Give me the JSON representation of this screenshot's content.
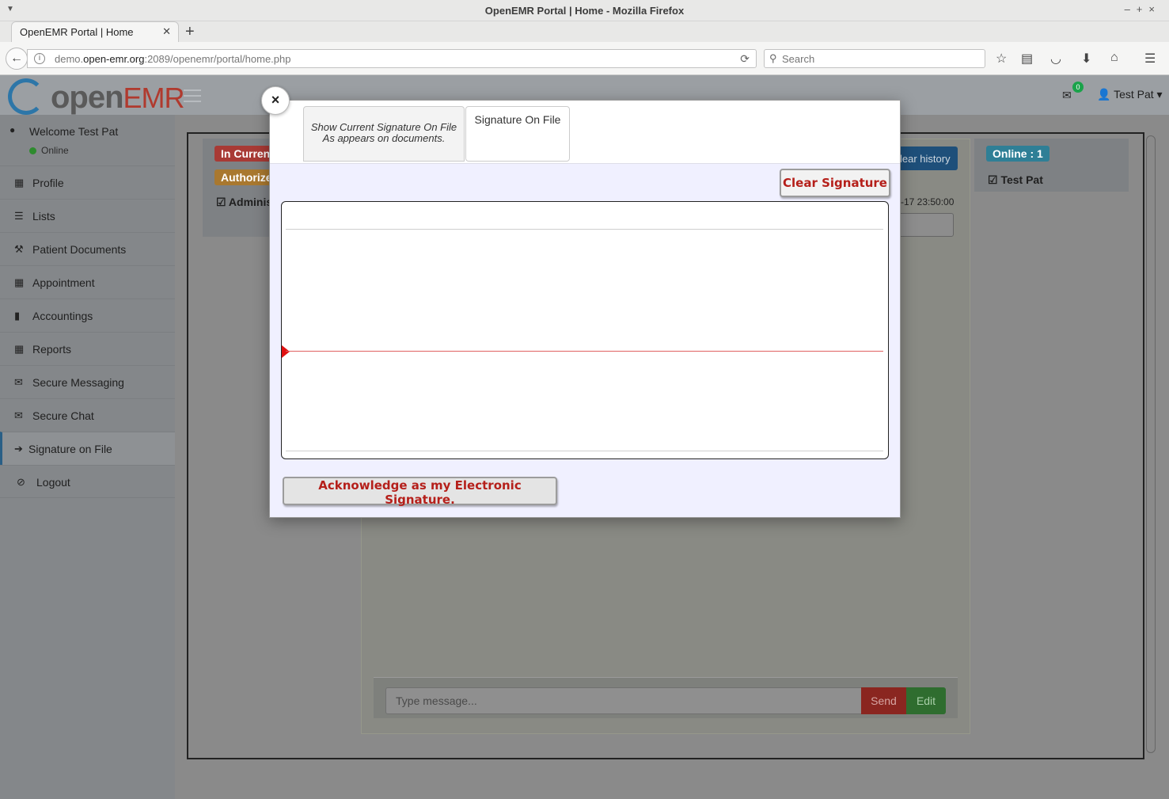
{
  "window": {
    "title": "OpenEMR Portal | Home - Mozilla Firefox"
  },
  "browser": {
    "tab_label": "OpenEMR Portal | Home",
    "url_prefix": "demo.",
    "url_host": "open-emr.org",
    "url_rest": ":2089/openemr/portal/home.php",
    "search_placeholder": "Search"
  },
  "portal": {
    "logo_text": "open",
    "logo_emr": "EMR",
    "mail_count": "0",
    "user_name": "Test Pat ▾",
    "welcome": "Welcome Test Pat",
    "status": "Online"
  },
  "sidebar": {
    "items": [
      {
        "label": "Profile",
        "icon": "calendar-icon"
      },
      {
        "label": "Lists",
        "icon": "list-icon"
      },
      {
        "label": "Patient Documents",
        "icon": "gavel-icon"
      },
      {
        "label": "Appointment",
        "icon": "calendar-icon"
      },
      {
        "label": "Accountings",
        "icon": "book-icon"
      },
      {
        "label": "Reports",
        "icon": "calendar-icon"
      },
      {
        "label": "Secure Messaging",
        "icon": "envelope-icon"
      },
      {
        "label": "Secure Chat",
        "icon": "envelope-icon"
      },
      {
        "label": "Signature on File",
        "icon": "sign-in-icon"
      },
      {
        "label": "Logout",
        "icon": "ban-icon"
      }
    ]
  },
  "chat": {
    "badge_current": "In Curren",
    "badge_authorized": "Authorize",
    "admin_label": "Adminis",
    "clear_history": "lear history",
    "timestamp": "-17 23:50:00",
    "online_badge": "Online : 1",
    "online_user": "Test Pat",
    "message_placeholder": "Type message...",
    "send_label": "Send",
    "edit_label": "Edit"
  },
  "modal": {
    "close_label": "×",
    "tab1_line1": "Show Current Signature On File",
    "tab1_line2": "As appears on documents.",
    "tab2_label": "Signature On File",
    "clear_signature": "Clear Signature",
    "acknowledge": "Acknowledge as my Electronic Signature."
  },
  "colors": {
    "badge_red": "#c9302c",
    "badge_orange": "#e59a2c",
    "badge_info": "#3aa8c8",
    "accent_red": "#b51f1a"
  }
}
